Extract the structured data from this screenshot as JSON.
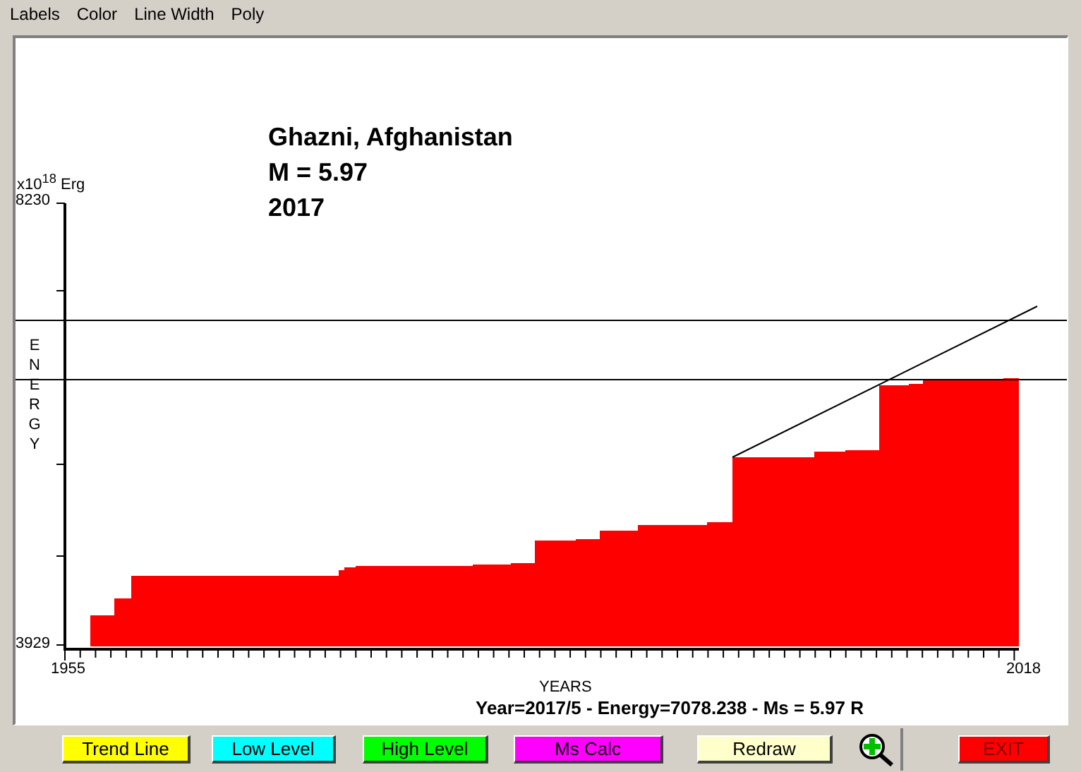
{
  "menu": [
    "Labels",
    "Color",
    "Line Width",
    "Poly"
  ],
  "chart": {
    "title_lines": [
      "Ghazni, Afghanistan",
      "M = 5.97",
      "2017"
    ],
    "y_axis": {
      "unit": "x10$^{18}$ Erg",
      "max": "8230",
      "min": "3929",
      "label": "ENERGY"
    },
    "x_axis": {
      "start": "1955",
      "end": "2018",
      "label": "YEARS"
    },
    "status": "Year=2017/5 - Energy=7078.238 - Ms = 5.97 R"
  },
  "buttons": [
    {
      "kind": "text",
      "label": "Trend Line",
      "color": "#ffff00"
    },
    {
      "kind": "text",
      "label": "Low Level",
      "color": "#00ffff"
    },
    {
      "kind": "text",
      "label": "High Level",
      "color": "#00ff00"
    },
    {
      "kind": "text",
      "label": "Ms Calc",
      "color": "#ff00ff"
    },
    {
      "kind": "text",
      "label": "Redraw",
      "color": "#ffffcc"
    },
    {
      "kind": "zoom"
    },
    {
      "kind": "exit",
      "label": "EXIT",
      "color": "#ff0000"
    }
  ]
}
